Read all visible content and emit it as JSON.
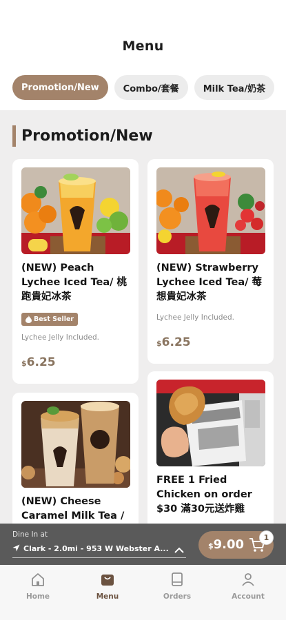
{
  "header": {
    "title": "Menu"
  },
  "tabs": [
    {
      "label": "Promotion/New"
    },
    {
      "label": "Combo/套餐"
    },
    {
      "label": "Milk Tea/奶茶"
    }
  ],
  "section": {
    "title": "Promotion/New"
  },
  "products": [
    {
      "name": "(NEW) Peach Lychee Iced Tea/ 桃跑貴妃冰茶",
      "badge": "Best Seller",
      "description": "Lychee Jelly Included.",
      "currency": "$",
      "price": "6.25"
    },
    {
      "name": "(NEW) Strawberry Lychee Iced Tea/ 莓想貴妃冰茶",
      "description": "Lychee Jelly Included.",
      "currency": "$",
      "price": "6.25"
    },
    {
      "name": "(NEW) Cheese Caramel Milk Tea /"
    },
    {
      "name": "FREE 1 Fried Chicken on order $30 滿30元送炸雞"
    }
  ],
  "order_bar": {
    "dine_label": "Dine In at",
    "location": "Clark - 2.0mi - 953 W Webster A...",
    "cart_currency": "$",
    "cart_total": "9.00",
    "cart_count": "1"
  },
  "nav": [
    {
      "label": "Home",
      "icon": "home-icon"
    },
    {
      "label": "Menu",
      "icon": "menu-bag-icon",
      "active": true
    },
    {
      "label": "Orders",
      "icon": "orders-icon"
    },
    {
      "label": "Account",
      "icon": "account-icon"
    }
  ],
  "colors": {
    "accent": "#a3836a",
    "price": "#8a7560",
    "bar": "#5a5a5a"
  }
}
